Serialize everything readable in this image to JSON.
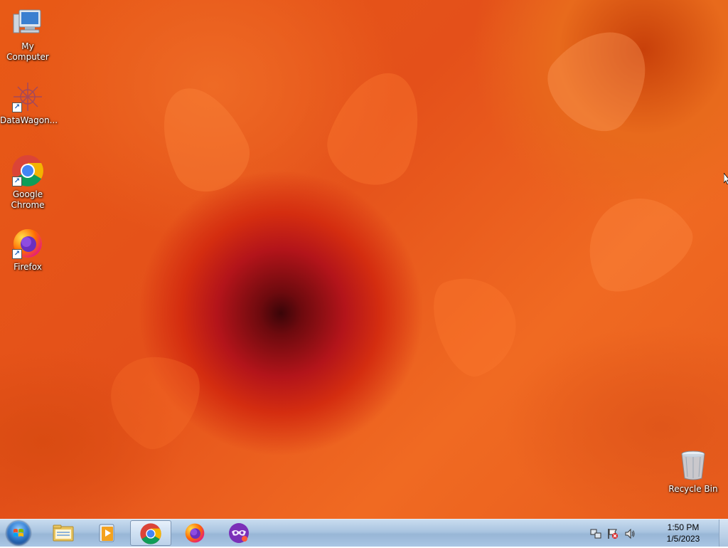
{
  "desktop": {
    "icons": [
      {
        "label": "My Computer",
        "icon": "computer-icon"
      },
      {
        "label": "DataWagon...",
        "icon": "datawagon-icon"
      },
      {
        "label": "Google Chrome",
        "icon": "chrome-icon"
      },
      {
        "label": "Firefox",
        "icon": "firefox-icon"
      },
      {
        "label": "Recycle Bin",
        "icon": "recycle-bin-icon"
      }
    ]
  },
  "taskbar": {
    "start": {
      "icon": "windows-start-orb-icon"
    },
    "pinned": [
      {
        "name": "File Explorer",
        "icon": "file-explorer-icon",
        "active": false
      },
      {
        "name": "Media Player",
        "icon": "media-player-icon",
        "active": false
      },
      {
        "name": "Google Chrome",
        "icon": "chrome-icon",
        "active": true
      },
      {
        "name": "Firefox",
        "icon": "firefox-icon",
        "active": false
      },
      {
        "name": "Incognito",
        "icon": "mask-app-icon",
        "active": false
      }
    ],
    "tray": {
      "icons": [
        "network-icon",
        "action-center-flag-icon",
        "speaker-icon"
      ],
      "time": "1:50 PM",
      "date": "1/5/2023"
    }
  },
  "colors": {
    "wallpaper": "#e85a16",
    "taskbar": "#a9c4e0",
    "chrome_red": "#db4437",
    "chrome_green": "#0f9d58",
    "chrome_yellow": "#f4b400",
    "chrome_blue": "#4285f4"
  }
}
